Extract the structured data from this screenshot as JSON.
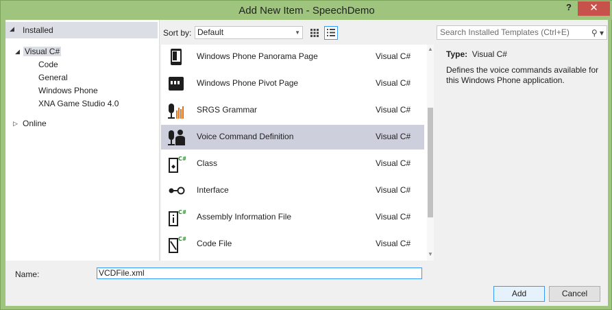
{
  "window": {
    "title": "Add New Item - SpeechDemo",
    "help_label": "?",
    "close_label": "✕"
  },
  "tree": {
    "installed_label": "Installed",
    "visual_csharp_label": "Visual C#",
    "children": [
      "Code",
      "General",
      "Windows Phone",
      "XNA Game Studio 4.0"
    ],
    "online_label": "Online"
  },
  "toolbar": {
    "sort_label": "Sort by:",
    "sort_value": "Default",
    "search_placeholder": "Search Installed Templates (Ctrl+E)"
  },
  "templates": [
    {
      "name": "Windows Phone Panorama Page",
      "lang": "Visual C#",
      "icon": "phone-panorama-icon"
    },
    {
      "name": "Windows Phone Pivot Page",
      "lang": "Visual C#",
      "icon": "phone-pivot-icon"
    },
    {
      "name": "SRGS Grammar",
      "lang": "Visual C#",
      "icon": "microphone-grammar-icon"
    },
    {
      "name": "Voice Command Definition",
      "lang": "Visual C#",
      "icon": "voice-command-icon",
      "selected": true
    },
    {
      "name": "Class",
      "lang": "Visual C#",
      "icon": "class-icon"
    },
    {
      "name": "Interface",
      "lang": "Visual C#",
      "icon": "interface-icon"
    },
    {
      "name": "Assembly Information File",
      "lang": "Visual C#",
      "icon": "assembly-info-icon"
    },
    {
      "name": "Code File",
      "lang": "Visual C#",
      "icon": "code-file-icon"
    }
  ],
  "description": {
    "type_label": "Type:",
    "type_value": "Visual C#",
    "text": "Defines the voice commands available for this Windows Phone application."
  },
  "footer": {
    "name_label": "Name:",
    "name_value": "VCDFile.xml",
    "add_label": "Add",
    "cancel_label": "Cancel"
  },
  "colors": {
    "titlebar": "#9ec47e",
    "close": "#c7514b",
    "selection": "#cdd0dc",
    "focus": "#3399ff"
  }
}
